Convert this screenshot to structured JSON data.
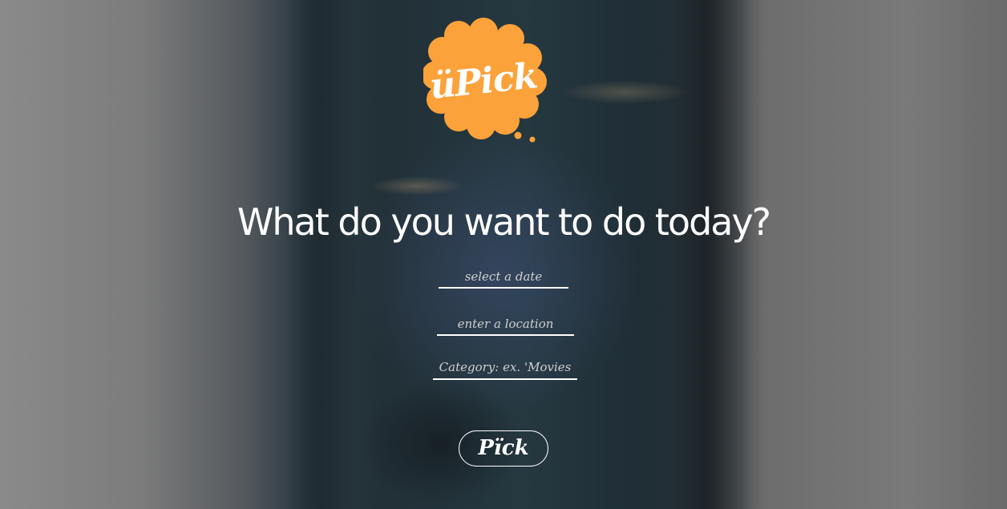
{
  "brand": {
    "logo_text": "üPick",
    "logo_color": "#FCA23A"
  },
  "main": {
    "headline": "What do you want to do today?"
  },
  "form": {
    "date_placeholder": "select a date",
    "location_placeholder": "enter a location",
    "category_placeholder": "Category: ex. 'Movies",
    "submit_label": "Pïck"
  }
}
